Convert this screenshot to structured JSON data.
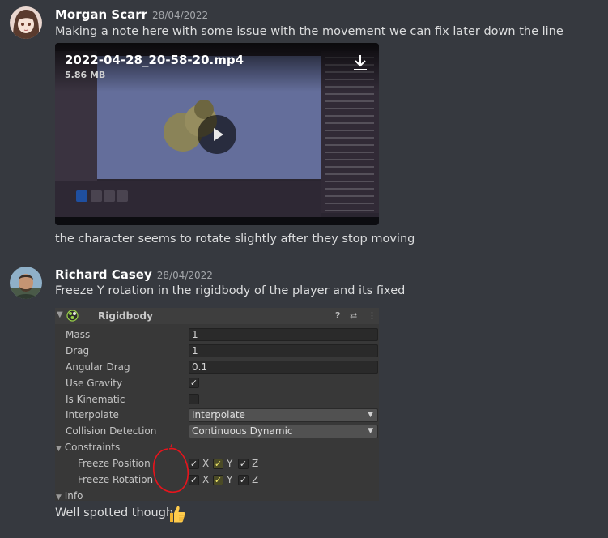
{
  "messages": [
    {
      "username": "Morgan Scarr",
      "timestamp": "28/04/2022",
      "text": "Making a note here with some issue with the movement we can fix later down the line",
      "attachment": {
        "filename": "2022-04-28_20-58-20.mp4",
        "filesize": "5.86 MB"
      },
      "followup": "the character seems to rotate slightly after they stop moving"
    },
    {
      "username": "Richard Casey",
      "timestamp": "28/04/2022",
      "text": "Freeze Y rotation in the rigidbody of the player and its fixed",
      "followup": "Well spotted though"
    }
  ],
  "rigidbody": {
    "title": "Rigidbody",
    "header_icons": [
      "help-icon",
      "sliders-icon",
      "kebab-menu-icon"
    ],
    "help_glyph": "?",
    "settings_glyph": "⇄",
    "menu_glyph": "⋮",
    "fold_glyph": "▼",
    "caret_glyph": "▼",
    "check_glyph": "✓",
    "properties": {
      "mass": {
        "label": "Mass",
        "value": "1"
      },
      "drag": {
        "label": "Drag",
        "value": "1"
      },
      "angular_drag": {
        "label": "Angular Drag",
        "value": "0.1"
      },
      "use_gravity": {
        "label": "Use Gravity",
        "checked": true
      },
      "is_kinematic": {
        "label": "Is Kinematic",
        "checked": false
      },
      "interpolate": {
        "label": "Interpolate",
        "value": "Interpolate"
      },
      "collision_detection": {
        "label": "Collision Detection",
        "value": "Continuous Dynamic"
      }
    },
    "constraints": {
      "label": "Constraints",
      "freeze_position": {
        "label": "Freeze Position",
        "x": true,
        "y": true,
        "z": true
      },
      "freeze_rotation": {
        "label": "Freeze Rotation",
        "x": true,
        "y": true,
        "z": true
      },
      "axis_labels": {
        "x": "X",
        "y": "Y",
        "z": "Z"
      }
    },
    "info_label": "Info"
  },
  "colors": {
    "background": "#36393f",
    "username": "#ffffff",
    "annotation_red": "#e8141c",
    "highlight_yellow": "#f0e868"
  }
}
